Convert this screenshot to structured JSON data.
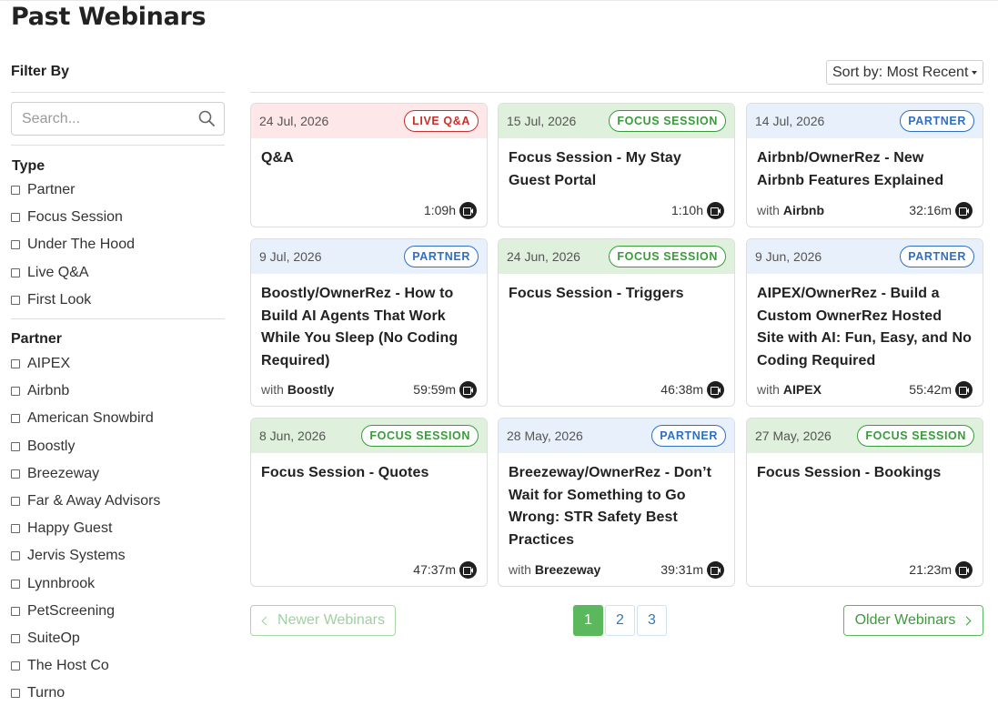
{
  "page_title": "Past Webinars",
  "sidebar": {
    "filter_title": "Filter By",
    "search_placeholder": "Search...",
    "type_title": "Type",
    "types": [
      "Partner",
      "Focus Session",
      "Under The Hood",
      "Live Q&A",
      "First Look"
    ],
    "partner_title": "Partner",
    "partners": [
      "AIPEX",
      "Airbnb",
      "American Snowbird",
      "Boostly",
      "Breezeway",
      "Far & Away Advisors",
      "Happy Guest",
      "Jervis Systems",
      "Lynnbrook",
      "PetScreening",
      "SuiteOp",
      "The Host Co",
      "Turno"
    ]
  },
  "sort": {
    "label": "Sort by: Most Recent"
  },
  "webinars": [
    {
      "date": "24 Jul, 2026",
      "type": "live",
      "badge": "LIVE Q&A",
      "title": "Q&A",
      "with_prefix": "",
      "with": "",
      "duration": "1:09h"
    },
    {
      "date": "15 Jul, 2026",
      "type": "focus",
      "badge": "FOCUS SESSION",
      "title": "Focus Session - My Stay Guest Portal",
      "with_prefix": "",
      "with": "",
      "duration": "1:10h"
    },
    {
      "date": "14 Jul, 2026",
      "type": "partner",
      "badge": "PARTNER",
      "title": "Airbnb/OwnerRez - New Airbnb Features Explained",
      "with_prefix": "with",
      "with": "Airbnb",
      "duration": "32:16m"
    },
    {
      "date": "9 Jul, 2026",
      "type": "partner",
      "badge": "PARTNER",
      "title": "Boostly/OwnerRez - How to Build AI Agents That Work While You Sleep (No Coding Required)",
      "with_prefix": "with",
      "with": "Boostly",
      "duration": "59:59m"
    },
    {
      "date": "24 Jun, 2026",
      "type": "focus",
      "badge": "FOCUS SESSION",
      "title": "Focus Session - Triggers",
      "with_prefix": "",
      "with": "",
      "duration": "46:38m"
    },
    {
      "date": "9 Jun, 2026",
      "type": "partner",
      "badge": "PARTNER",
      "title": "AIPEX/OwnerRez - Build a Custom OwnerRez Hosted Site with AI: Fun, Easy, and No Coding Required",
      "with_prefix": "with",
      "with": "AIPEX",
      "duration": "55:42m"
    },
    {
      "date": "8 Jun, 2026",
      "type": "focus",
      "badge": "FOCUS SESSION",
      "title": "Focus Session - Quotes",
      "with_prefix": "",
      "with": "",
      "duration": "47:37m"
    },
    {
      "date": "28 May, 2026",
      "type": "partner",
      "badge": "PARTNER",
      "title": "Breezeway/OwnerRez - Don’t Wait for Something to Go Wrong: STR Safety Best Practices",
      "with_prefix": "with",
      "with": "Breezeway",
      "duration": "39:31m"
    },
    {
      "date": "27 May, 2026",
      "type": "focus",
      "badge": "FOCUS SESSION",
      "title": "Focus Session - Bookings",
      "with_prefix": "",
      "with": "",
      "duration": "21:23m"
    }
  ],
  "pagination": {
    "newer_label": "Newer Webinars",
    "older_label": "Older Webinars",
    "pages": [
      "1",
      "2",
      "3"
    ],
    "active_page": "1"
  },
  "colors": {
    "live_accent": "#c9302c",
    "focus_accent": "#3a9b3a",
    "partner_accent": "#2e6fc4",
    "pagination_green": "#5cb85c"
  },
  "icons": {
    "search": "search-icon",
    "video": "video-camera-icon",
    "sort_caret": "caret-down-icon",
    "prev": "chevron-left-icon",
    "next": "chevron-right-icon"
  }
}
